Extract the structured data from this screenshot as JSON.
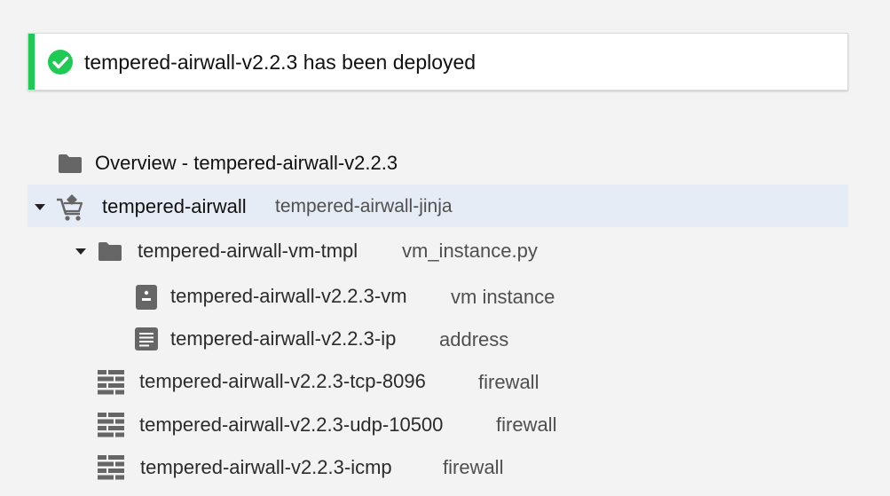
{
  "banner": {
    "message": "tempered-airwall-v2.2.3 has been deployed",
    "icon": "check-circle-icon",
    "accent_color": "#1ec954"
  },
  "tree": {
    "overview": {
      "label": "Overview - tempered-airwall-v2.2.3",
      "icon": "folder-icon"
    },
    "deployment": {
      "name": "tempered-airwall",
      "type": "tempered-airwall-jinja",
      "icon": "marketplace-cart-icon",
      "expanded": true,
      "selected_bg": "#e6ecf6"
    },
    "template": {
      "name": "tempered-airwall-vm-tmpl",
      "type": "vm_instance.py",
      "icon": "folder-icon",
      "expanded": true
    },
    "resources": [
      {
        "name": "tempered-airwall-v2.2.3-vm",
        "type": "vm instance",
        "icon": "vm-instance-icon"
      },
      {
        "name": "tempered-airwall-v2.2.3-ip",
        "type": "address",
        "icon": "address-icon"
      },
      {
        "name": "tempered-airwall-v2.2.3-tcp-8096",
        "type": "firewall",
        "icon": "firewall-icon"
      },
      {
        "name": "tempered-airwall-v2.2.3-udp-10500",
        "type": "firewall",
        "icon": "firewall-icon"
      },
      {
        "name": "tempered-airwall-v2.2.3-icmp",
        "type": "firewall",
        "icon": "firewall-icon"
      }
    ]
  }
}
